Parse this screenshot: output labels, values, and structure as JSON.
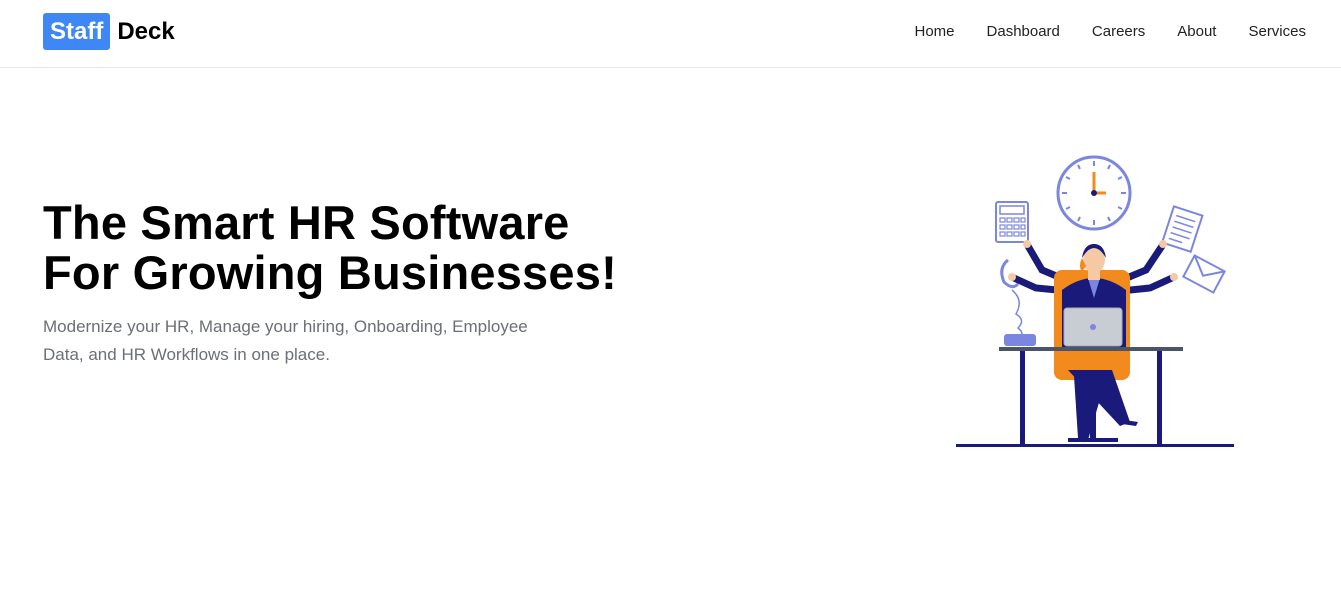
{
  "brand": {
    "badge_text": "Staff",
    "rest_text": "Deck",
    "badge_color": "#3f87f5"
  },
  "nav": {
    "items": [
      "Home",
      "Dashboard",
      "Careers",
      "About",
      "Services"
    ]
  },
  "hero": {
    "title_line1": "The Smart HR Software",
    "title_line2": "For Growing Businesses!",
    "subtitle_line1": "Modernize your HR, Manage your hiring, Onboarding, Employee",
    "subtitle_line2": "Data, and HR Workflows in one place."
  },
  "illustration": {
    "icons": [
      "clock-icon",
      "calculator-icon",
      "document-icon",
      "envelope-icon",
      "telephone-icon",
      "laptop-icon"
    ],
    "colors": {
      "primary": "#7b86e0",
      "navy": "#1a1a7a",
      "orange": "#f28a1e",
      "desk": "#4a5568"
    }
  }
}
